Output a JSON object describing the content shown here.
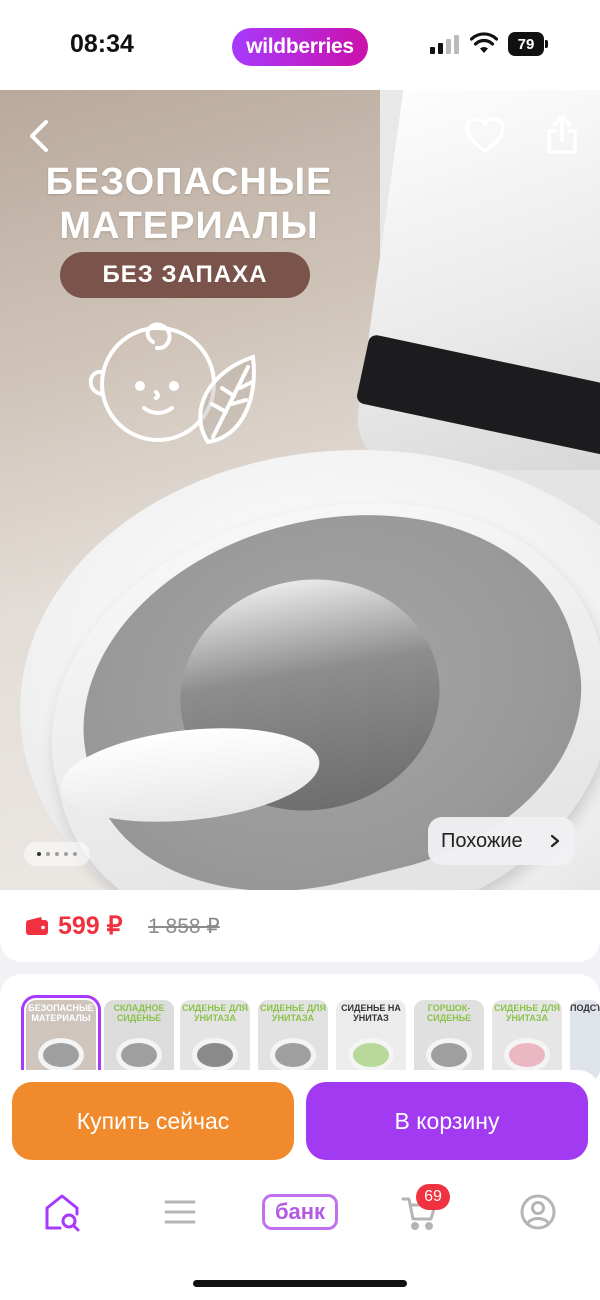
{
  "status_bar": {
    "time": "08:34",
    "brand": "wildberries",
    "battery": "79"
  },
  "gallery": {
    "promo_title_line1": "БЕЗОПАСНЫЕ",
    "promo_title_line2": "МАТЕРИАЛЫ",
    "promo_badge": "БЕЗ ЗАПАХА",
    "similar_label": "Похожие",
    "dots_count": 5,
    "active_dot": 1
  },
  "price": {
    "current": "599 ₽",
    "old": "1 858 ₽"
  },
  "thumbnails": [
    {
      "caption": "БЕЗОПАСНЫЕ МАТЕРИАЛЫ",
      "selected": true
    },
    {
      "caption": "СКЛАДНОЕ СИДЕНЬЕ",
      "selected": false
    },
    {
      "caption": "СИДЕНЬЕ ДЛЯ УНИТАЗА",
      "selected": false
    },
    {
      "caption": "СИДЕНЬЕ ДЛЯ УНИТАЗА",
      "selected": false
    },
    {
      "caption": "СИДЕНЬЕ НА УНИТАЗ",
      "selected": false
    },
    {
      "caption": "ГОРШОК-СИДЕНЬЕ",
      "selected": false
    },
    {
      "caption": "СИДЕНЬЕ ДЛЯ УНИТАЗА",
      "selected": false
    },
    {
      "caption": "ПОДСТ",
      "selected": false
    }
  ],
  "actions": {
    "buy_now": "Купить сейчас",
    "add_to_cart": "В корзину"
  },
  "tabbar": {
    "bank_label": "банк",
    "cart_badge": "69"
  },
  "colors": {
    "brand": "#a73afd",
    "buy": "#f08a2c",
    "cart": "#a23af1",
    "price": "#f0313f"
  }
}
